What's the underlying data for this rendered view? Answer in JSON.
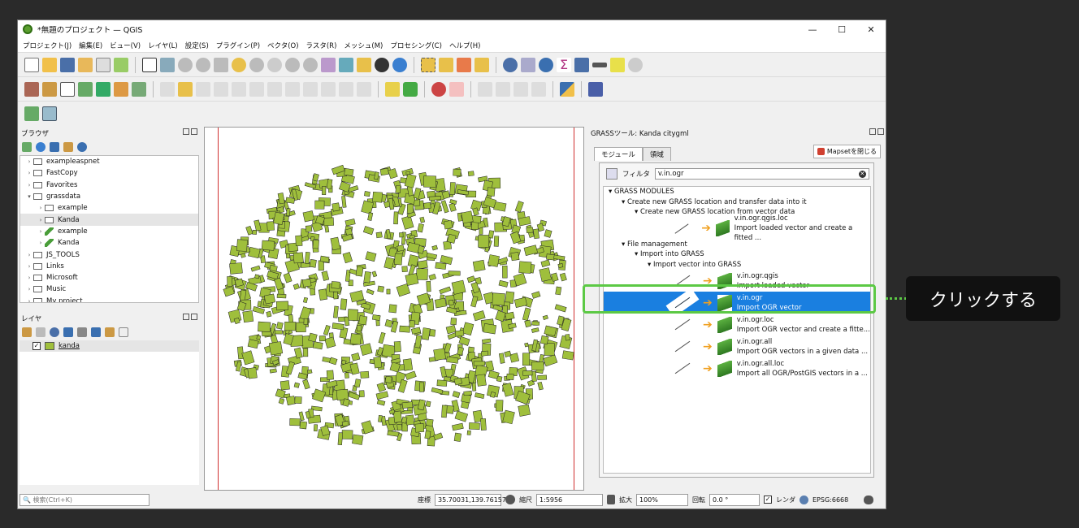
{
  "window": {
    "title": "*無題のプロジェクト — QGIS",
    "minimize": "—",
    "maximize": "☐",
    "close": "✕"
  },
  "menu": [
    "プロジェクト(J)",
    "編集(E)",
    "ビュー(V)",
    "レイヤ(L)",
    "設定(S)",
    "プラグイン(P)",
    "ベクタ(O)",
    "ラスタ(R)",
    "メッシュ(M)",
    "プロセシング(C)",
    "ヘルプ(H)"
  ],
  "browser": {
    "title": "ブラウザ",
    "items": [
      {
        "label": "exampleaspnet",
        "indent": 1,
        "type": "folder",
        "expanded": false
      },
      {
        "label": "FastCopy",
        "indent": 1,
        "type": "folder",
        "expanded": false
      },
      {
        "label": "Favorites",
        "indent": 1,
        "type": "folder",
        "expanded": false
      },
      {
        "label": "grassdata",
        "indent": 1,
        "type": "folder",
        "expanded": true
      },
      {
        "label": "example",
        "indent": 2,
        "type": "folder",
        "expanded": false
      },
      {
        "label": "Kanda",
        "indent": 2,
        "type": "folder",
        "expanded": false,
        "selected": true
      },
      {
        "label": "example",
        "indent": 2,
        "type": "grass",
        "expanded": false
      },
      {
        "label": "Kanda",
        "indent": 2,
        "type": "grass",
        "expanded": false
      },
      {
        "label": "JS_TOOLS",
        "indent": 1,
        "type": "folder",
        "expanded": false
      },
      {
        "label": "Links",
        "indent": 1,
        "type": "folder",
        "expanded": false
      },
      {
        "label": "Microsoft",
        "indent": 1,
        "type": "folder",
        "expanded": false
      },
      {
        "label": "Music",
        "indent": 1,
        "type": "folder",
        "expanded": false
      },
      {
        "label": "My project",
        "indent": 1,
        "type": "folder",
        "expanded": false
      }
    ]
  },
  "layers": {
    "title": "レイヤ",
    "items": [
      {
        "label": "kanda",
        "checked": true,
        "color": "#9fbf3c"
      }
    ]
  },
  "grass": {
    "title": "GRASSツール: Kanda citygml",
    "tabs": [
      "モジュール",
      "領域"
    ],
    "close_mapset": "Mapsetを閉じる",
    "filter_label": "フィルタ",
    "filter_value": "v.in.ogr",
    "tree": [
      {
        "label": "GRASS MODULES",
        "indent": 0
      },
      {
        "label": "Create new GRASS location and transfer data into it",
        "indent": 1
      },
      {
        "label": "Create new GRASS location from vector data",
        "indent": 2
      }
    ],
    "modules_a": [
      {
        "name": "v.in.ogr.qgis.loc",
        "desc": "Import loaded vector and create a fitted ..."
      }
    ],
    "tree_b": [
      {
        "label": "File management",
        "indent": 1
      },
      {
        "label": "Import into GRASS",
        "indent": 2
      },
      {
        "label": "Import vector into GRASS",
        "indent": 3
      }
    ],
    "modules_b": [
      {
        "name": "v.in.ogr.qgis",
        "desc": "Import loaded vector"
      },
      {
        "name": "v.in.ogr",
        "desc": "Import OGR vector",
        "selected": true
      },
      {
        "name": "v.in.ogr.loc",
        "desc": "Import OGR vector and create a fitte..."
      },
      {
        "name": "v.in.ogr.all",
        "desc": "Import OGR vectors in a given data ..."
      },
      {
        "name": "v.in.ogr.all.loc",
        "desc": "Import all OGR/PostGIS vectors in a ..."
      }
    ]
  },
  "callout": "クリックする",
  "status": {
    "search_placeholder": "検索(Ctrl+K)",
    "coord_label": "座標",
    "coord_value": "35.70031,139.76157",
    "scale_label": "縮尺",
    "scale_value": "1:5956",
    "mag_label": "拡大",
    "mag_value": "100%",
    "rot_label": "回転",
    "rot_value": "0.0 °",
    "render_label": "レンダ",
    "crs": "EPSG:6668"
  },
  "colors": {
    "building": "#9fbf3c",
    "select": "#1a7fe0",
    "highlight": "#5cc945"
  }
}
